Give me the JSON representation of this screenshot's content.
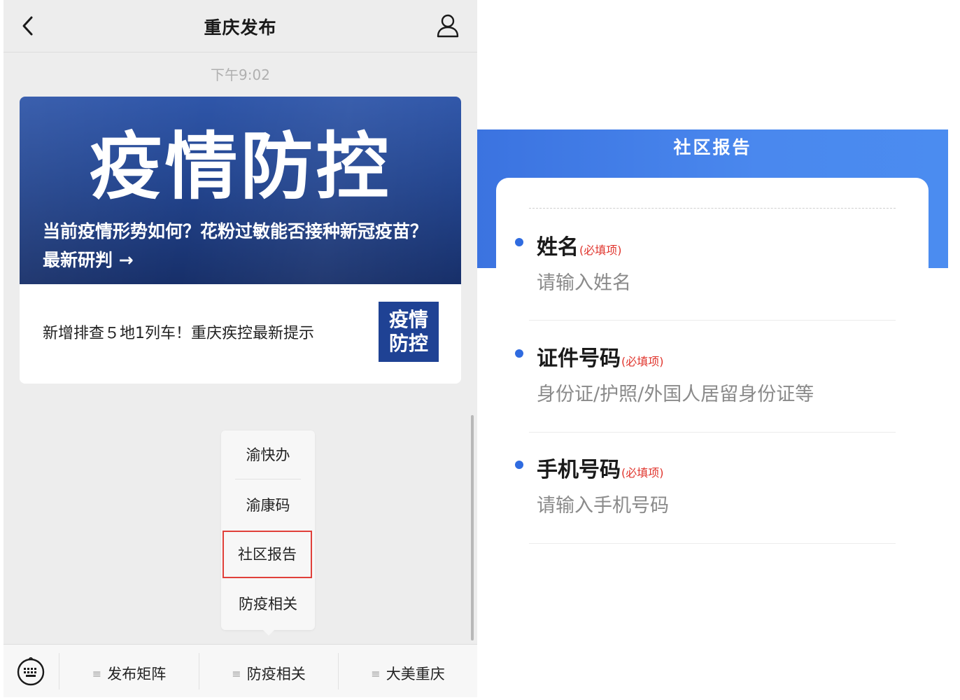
{
  "chat": {
    "title": "重庆发布",
    "timestamp": "下午9:02",
    "article": {
      "banner_title": "疫情防控",
      "banner_subtitle": "当前疫情形势如何？花粉过敏能否接种新冠疫苗？最新研判 →",
      "news_title": "新增排查５地1列车！重庆疾控最新提示",
      "thumb_line1": "疫情",
      "thumb_line2": "防控"
    },
    "popup_menu": {
      "items": [
        {
          "label": "渝快办"
        },
        {
          "label": "渝康码"
        },
        {
          "label": "社区报告"
        },
        {
          "label": "防疫相关"
        }
      ]
    },
    "bottom_tabs": [
      {
        "label": "发布矩阵"
      },
      {
        "label": "防疫相关"
      },
      {
        "label": "大美重庆"
      }
    ]
  },
  "form": {
    "title": "社区报告",
    "required_tag": "(必填项)",
    "fields": [
      {
        "label": "姓名",
        "placeholder": "请输入姓名"
      },
      {
        "label": "证件号码",
        "placeholder": "身份证/护照/外国人居留身份证等"
      },
      {
        "label": "手机号码",
        "placeholder": "请输入手机号码"
      }
    ]
  },
  "colors": {
    "banner_blue": "#23458f",
    "form_header_blue": "#4a88ee",
    "required_red": "#e0342c",
    "highlight_border": "#e0403a"
  }
}
